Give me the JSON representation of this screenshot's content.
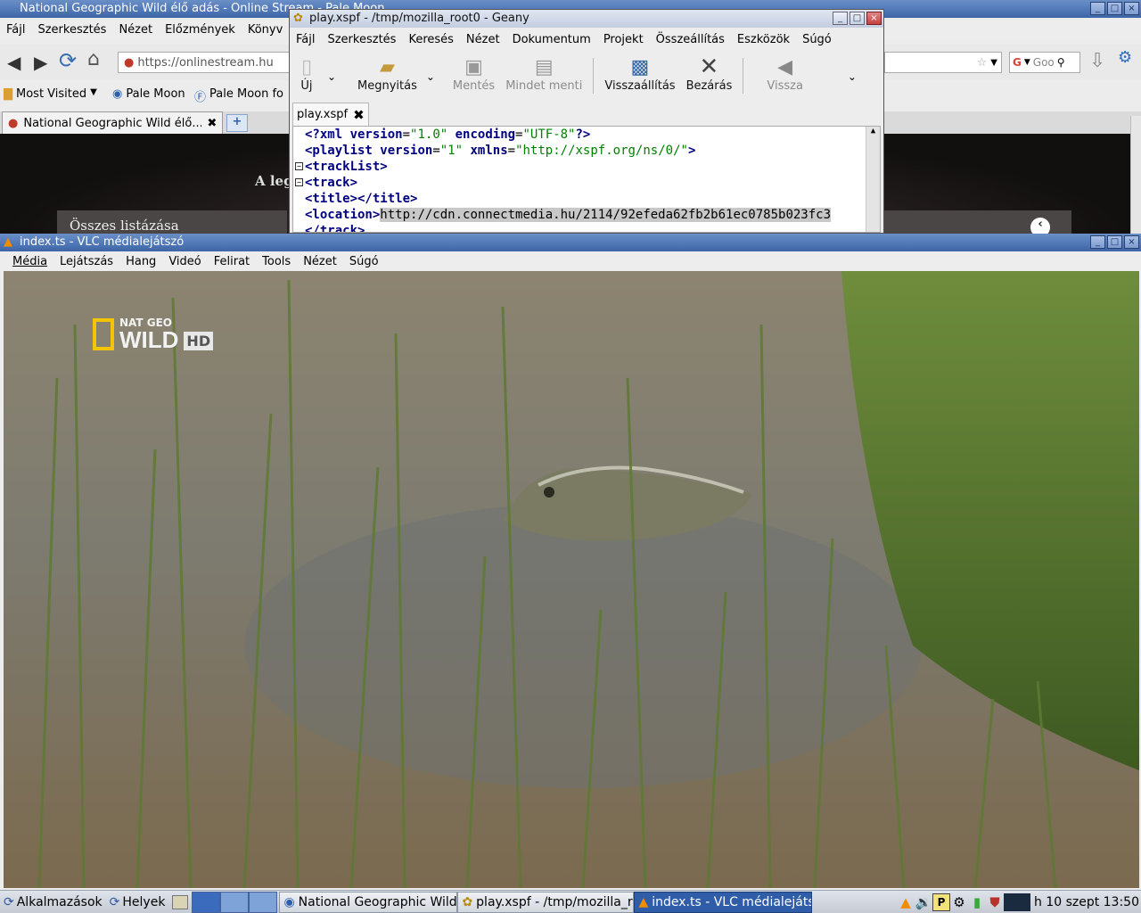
{
  "palemoon": {
    "title": "National Geographic Wild élő adás - Online Stream - Pale Moon",
    "menu": [
      "Fájl",
      "Szerkesztés",
      "Nézet",
      "Előzmények",
      "Könyv"
    ],
    "url": "https://onlinestream.hu",
    "search_placeholder": "Goo",
    "bookmarks": [
      "Most Visited",
      "Pale Moon",
      "Pale Moon fo"
    ],
    "tab_title": "National Geographic Wild élő...",
    "page_text_1": "A leg",
    "page_text_2": "Összes listázása"
  },
  "geany": {
    "title": "play.xspf - /tmp/mozilla_root0 - Geany",
    "menu": [
      "Fájl",
      "Szerkesztés",
      "Keresés",
      "Nézet",
      "Dokumentum",
      "Projekt",
      "Összeállítás",
      "Eszközök",
      "Súgó"
    ],
    "toolbar": {
      "new": "Új",
      "open": "Megnyitás",
      "save": "Mentés",
      "save_all": "Mindet menti",
      "revert": "Visszaállítás",
      "close": "Bezárás",
      "back": "Vissza"
    },
    "tab": "play.xspf",
    "code": {
      "l1_a": "<?xml ",
      "l1_b": "version",
      "l1_c": "=",
      "l1_d": "\"1.0\"",
      "l1_e": " encoding",
      "l1_f": "=",
      "l1_g": "\"UTF-8\"",
      "l1_h": "?>",
      "l2_a": "<playlist ",
      "l2_b": "version",
      "l2_c": "=",
      "l2_d": "\"1\"",
      "l2_e": " xmlns",
      "l2_f": "=",
      "l2_g": "\"http://xspf.org/ns/0/\"",
      "l2_h": ">",
      "l3": "<trackList>",
      "l4": "<track>",
      "l5": "<title></title>",
      "l6_tag": "<location>",
      "l6_url": "http://cdn.connectmedia.hu/2114/92efeda62fb2b61ec0785b023fc3",
      "l7": "</track>"
    }
  },
  "vlc": {
    "title": "index.ts - VLC médialejátszó",
    "menu": [
      "Média",
      "Lejátszás",
      "Hang",
      "Videó",
      "Felirat",
      "Tools",
      "Nézet",
      "Súgó"
    ],
    "logo_top": "NAT GEO",
    "logo_main": "WILD",
    "logo_hd": "HD"
  },
  "taskbar": {
    "apps": "Alkalmazások",
    "places": "Helyek",
    "tasks": [
      "National Geographic Wild é",
      "play.xspf - /tmp/mozilla_rc",
      "index.ts - VLC médialejáts:"
    ],
    "clock": "h 10 szept 13:50"
  },
  "colors": {
    "titlebar_blue": "#3d66a8",
    "xml_tag": "#000080",
    "xml_string": "#008000",
    "natgeo_yellow": "#f4c400"
  }
}
